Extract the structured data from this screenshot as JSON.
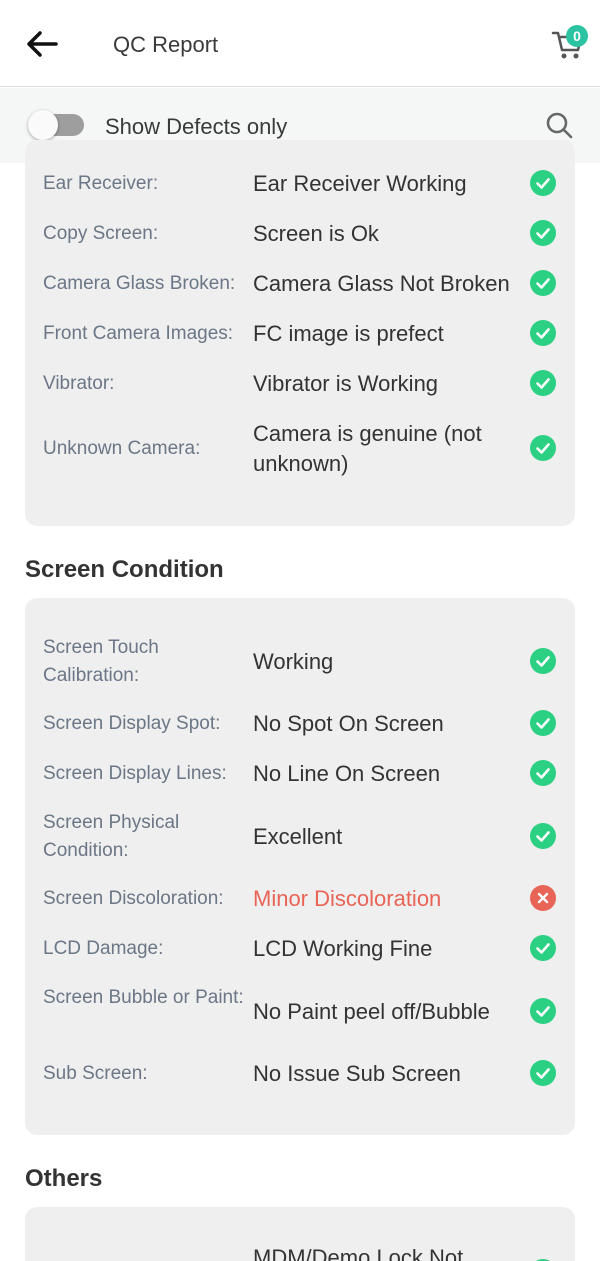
{
  "header": {
    "title": "QC Report",
    "cart_count": "0"
  },
  "filter": {
    "label": "Show Defects only",
    "enabled": false
  },
  "colors": {
    "ok": "#2bd082",
    "defect": "#e86457",
    "accent": "#2cc3a3"
  },
  "top_section": {
    "rows": [
      {
        "label": "Ear Receiver:",
        "value": "Ear Receiver Working",
        "status": "ok"
      },
      {
        "label": "Copy Screen:",
        "value": "Screen is Ok",
        "status": "ok"
      },
      {
        "label": "Camera Glass Broken:",
        "value": "Camera Glass Not Broken",
        "status": "ok"
      },
      {
        "label": "Front Camera Images:",
        "value": "FC image is prefect",
        "status": "ok"
      },
      {
        "label": "Vibrator:",
        "value": "Vibrator is Working",
        "status": "ok"
      },
      {
        "label": "Unknown Camera:",
        "value": "Camera is genuine (not unknown)",
        "status": "ok"
      }
    ]
  },
  "screen_condition": {
    "title": "Screen Condition",
    "rows": [
      {
        "label": "Screen Touch Calibration:",
        "value": "Working",
        "status": "ok"
      },
      {
        "label": "Screen Display Spot:",
        "value": "No Spot On Screen",
        "status": "ok"
      },
      {
        "label": "Screen Display Lines:",
        "value": "No Line On Screen",
        "status": "ok"
      },
      {
        "label": "Screen Physical Condition:",
        "value": "Excellent",
        "status": "ok"
      },
      {
        "label": "Screen Discoloration:",
        "value": "Minor Discoloration",
        "status": "defect"
      },
      {
        "label": "LCD Damage:",
        "value": "LCD Working Fine",
        "status": "ok"
      },
      {
        "label": "Screen Bubble or Paint:",
        "value": "No Paint peel off/Bubble",
        "status": "ok"
      },
      {
        "label": "Sub Screen:",
        "value": "No Issue Sub Screen",
        "status": "ok"
      }
    ]
  },
  "others": {
    "title": "Others",
    "rows": [
      {
        "label": "",
        "value": "MDM/Demo Lock Not",
        "status": "ok"
      }
    ]
  }
}
